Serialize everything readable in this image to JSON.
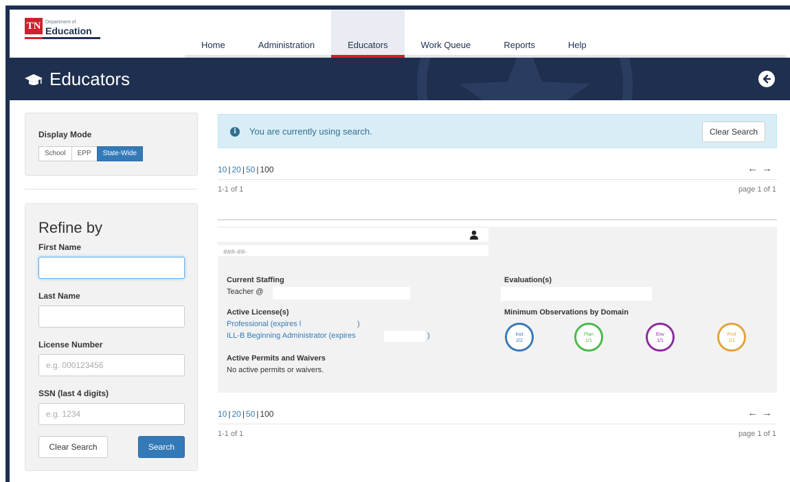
{
  "brand": {
    "logo_mark": "TN",
    "dept_line": "Department of",
    "name_line": "Education"
  },
  "nav": {
    "items": [
      {
        "label": "Home",
        "active": false
      },
      {
        "label": "Administration",
        "active": false
      },
      {
        "label": "Educators",
        "active": true
      },
      {
        "label": "Work Queue",
        "active": false
      },
      {
        "label": "Reports",
        "active": false
      },
      {
        "label": "Help",
        "active": false
      }
    ]
  },
  "banner": {
    "title": "Educators",
    "icon": "graduation-cap-icon",
    "back_icon": "circle-arrow-left-icon"
  },
  "display_mode": {
    "label": "Display Mode",
    "options": [
      "School",
      "EPP",
      "State-Wide"
    ],
    "selected": "State-Wide"
  },
  "refine": {
    "title": "Refine by",
    "first_name": {
      "label": "First Name",
      "value": "",
      "placeholder": ""
    },
    "last_name": {
      "label": "Last Name",
      "value": "",
      "placeholder": ""
    },
    "license_number": {
      "label": "License Number",
      "value": "",
      "placeholder": "e.g. 000123456"
    },
    "ssn": {
      "label": "SSN (last 4 digits)",
      "value": "",
      "placeholder": "e.g. 1234"
    },
    "clear_label": "Clear Search",
    "search_label": "Search"
  },
  "alert": {
    "icon": "info-icon",
    "text": "You are currently using search.",
    "button_label": "Clear Search"
  },
  "pagination": {
    "sizes": [
      "10",
      "20",
      "50",
      "100"
    ],
    "current_size": "100",
    "range_text": "1-1 of 1",
    "page_text": "page 1 of 1",
    "prev_icon": "arrow-left-icon",
    "next_icon": "arrow-right-icon"
  },
  "result": {
    "ssn_mask": "###-##-",
    "person_icon": "user-icon",
    "staffing_label": "Current Staffing",
    "staffing_value": "Teacher @",
    "licenses_label": "Active License(s)",
    "licenses": [
      "Professional (expires l",
      ")",
      "ILL-B Beginning Administrator (expires",
      ")"
    ],
    "permits_label": "Active Permits and Waivers",
    "permits_value": "No active permits or waivers.",
    "evaluations_label": "Evaluation(s)",
    "observations_label": "Minimum Observations by Domain",
    "observations": [
      {
        "name": "Inst",
        "value": "2/2",
        "color": "#3a78b5"
      },
      {
        "name": "Plan",
        "value": "1/1",
        "color": "#4cb84c"
      },
      {
        "name": "Env",
        "value": "1/1",
        "color": "#8a2c9c"
      },
      {
        "name": "Prof",
        "value": "1/1",
        "color": "#e3a33a"
      }
    ]
  },
  "colors": {
    "navy": "#1e2f4f",
    "brand_red": "#d0202e",
    "primary": "#337ab7",
    "alert_bg": "#d9edf7"
  }
}
